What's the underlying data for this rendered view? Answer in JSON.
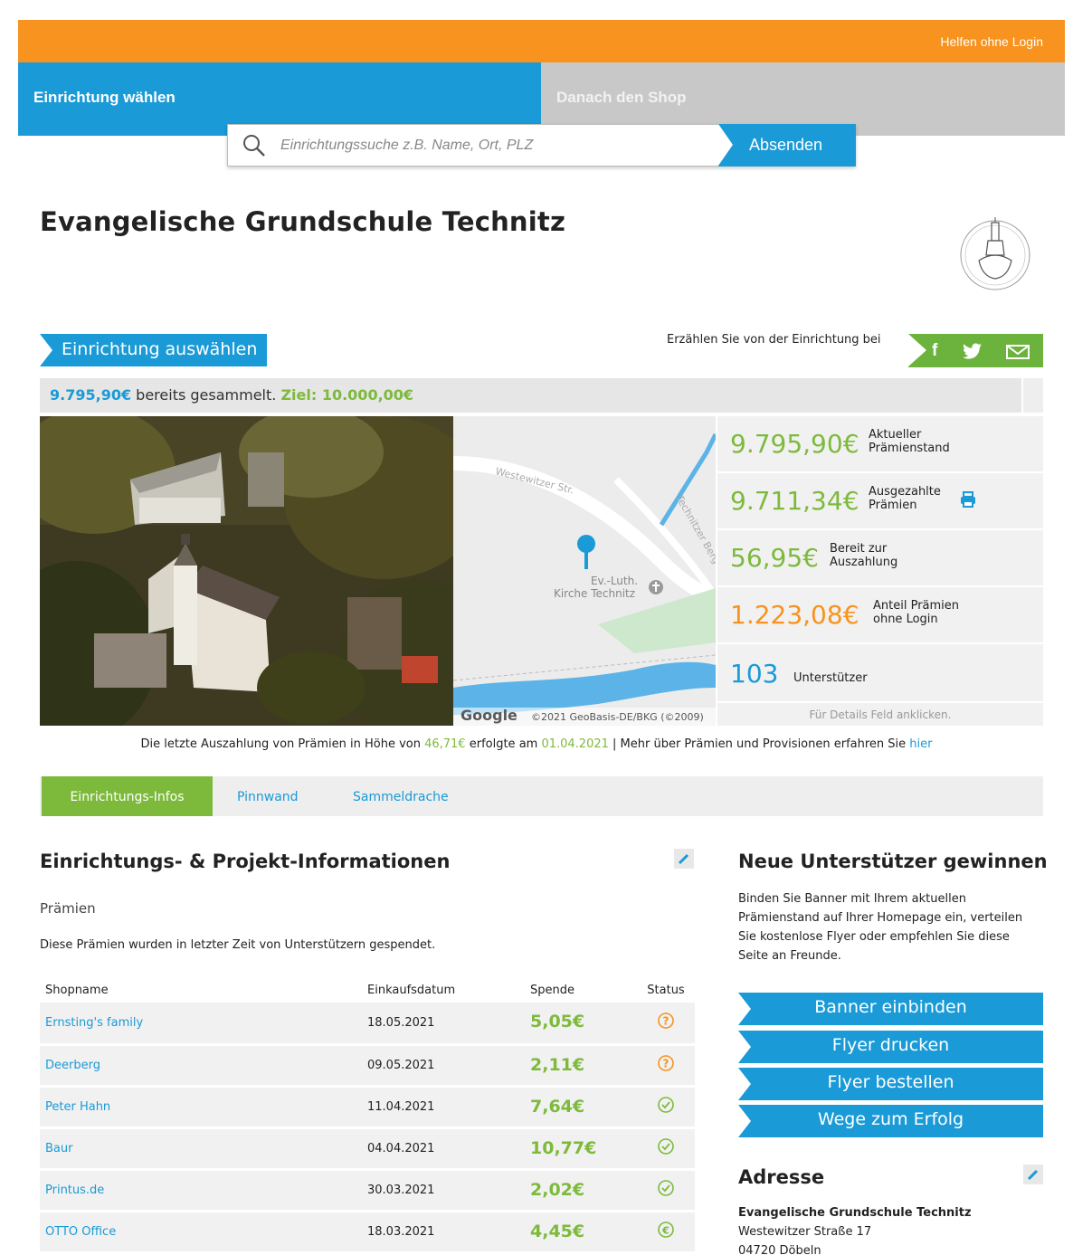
{
  "topbar": {
    "login_link": "Helfen ohne Login"
  },
  "steps": {
    "step1": "Einrichtung wählen",
    "step2": "Danach den Shop"
  },
  "search": {
    "placeholder": "Einrichtungssuche z.B. Name, Ort, PLZ",
    "button": "Absenden"
  },
  "page_title": "Evangelische Grundschule Technitz",
  "select_button": "Einrichtung auswählen",
  "share": {
    "text": "Erzählen Sie von der Einrichtung bei",
    "icons": [
      "facebook-icon",
      "twitter-icon",
      "mail-icon"
    ]
  },
  "collected": {
    "amount": "9.795,90€",
    "text": " bereits gesammelt. ",
    "goal": "Ziel: 10.000,00€"
  },
  "map": {
    "street1": "Westewitzer Str.",
    "street2": "Technitzer Berg",
    "poi_line1": "Ev.-Luth.",
    "poi_line2": "Kirche Technitz",
    "attribution": "©2021 GeoBasis-DE/BKG (©2009)",
    "google": "Google"
  },
  "stats": {
    "current": {
      "value": "9.795,90€",
      "label1": "Aktueller",
      "label2": "Prämienstand"
    },
    "paid": {
      "value": "9.711,34€",
      "label1": "Ausgezahlte",
      "label2": "Prämien"
    },
    "ready": {
      "value": "56,95€",
      "label1": "Bereit zur",
      "label2": "Auszahlung"
    },
    "nologin": {
      "value": "1.223,08€",
      "label1": "Anteil Prämien",
      "label2": "ohne Login"
    },
    "supporters": {
      "value": "103",
      "label": "Unterstützer"
    },
    "hint": "Für Details Feld anklicken."
  },
  "payout": {
    "pre": "Die letzte Auszahlung von Prämien in Höhe von ",
    "amount": "46,71€",
    "mid": " erfolgte am ",
    "date": "01.04.2021",
    "post": " | Mehr über Prämien und Provisionen erfahren Sie ",
    "link": "hier"
  },
  "tabs": [
    "Einrichtungs-Infos",
    "Pinnwand",
    "Sammeldrache"
  ],
  "info": {
    "heading": "Einrichtungs- & Projekt-Informationen",
    "sub": "Prämien",
    "desc": "Diese Prämien wurden in letzter Zeit von Unterstützern gespendet.",
    "columns": [
      "Shopname",
      "Einkaufsdatum",
      "Spende",
      "Status"
    ],
    "rows": [
      {
        "shop": "Ernsting's family",
        "date": "18.05.2021",
        "amount": "5,05€",
        "status": "pending"
      },
      {
        "shop": "Deerberg",
        "date": "09.05.2021",
        "amount": "2,11€",
        "status": "pending"
      },
      {
        "shop": "Peter Hahn",
        "date": "11.04.2021",
        "amount": "7,64€",
        "status": "confirmed"
      },
      {
        "shop": "Baur",
        "date": "04.04.2021",
        "amount": "10,77€",
        "status": "confirmed"
      },
      {
        "shop": "Printus.de",
        "date": "30.03.2021",
        "amount": "2,02€",
        "status": "confirmed"
      },
      {
        "shop": "OTTO Office",
        "date": "18.03.2021",
        "amount": "4,45€",
        "status": "paid"
      }
    ]
  },
  "sidebar": {
    "heading": "Neue Unterstützer gewinnen",
    "text": "Binden Sie Banner mit Ihrem aktuellen Prämienstand auf Ihrer Homepage ein, verteilen Sie kostenlose Flyer oder empfehlen Sie diese Seite an Freunde.",
    "buttons": [
      "Banner einbinden",
      "Flyer drucken",
      "Flyer bestellen",
      "Wege zum Erfolg"
    ],
    "address_heading": "Adresse",
    "address": {
      "name": "Evangelische Grundschule Technitz",
      "street": "Westewitzer Straße 17",
      "city": "04720 Döbeln"
    }
  },
  "colors": {
    "orange": "#f7931e",
    "blue": "#1a9ad6",
    "green": "#7dba3c",
    "grey": "#c8c8c8"
  }
}
